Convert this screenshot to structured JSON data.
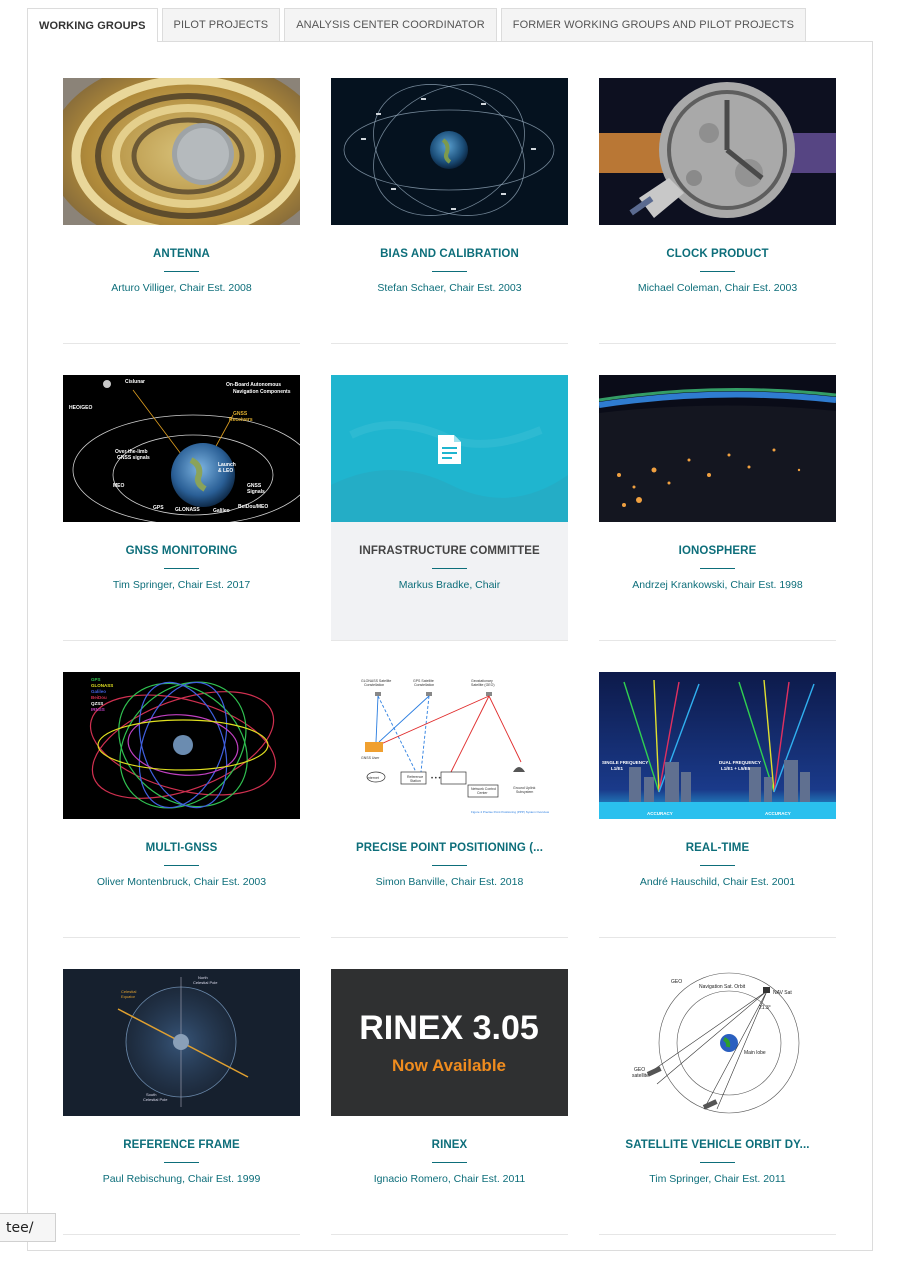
{
  "tabs": [
    {
      "label": "WORKING GROUPS",
      "active": true
    },
    {
      "label": "PILOT PROJECTS",
      "active": false
    },
    {
      "label": "ANALYSIS CENTER COORDINATOR",
      "active": false
    },
    {
      "label": "FORMER WORKING GROUPS AND PILOT PROJECTS",
      "active": false
    }
  ],
  "cards": [
    {
      "title": "ANTENNA",
      "subtitle": "Arturo Villiger, Chair Est. 2008",
      "image": "antenna-photo"
    },
    {
      "title": "BIAS AND CALIBRATION",
      "subtitle": "Stefan Schaer, Chair Est. 2003",
      "image": "earth-orbits-image"
    },
    {
      "title": "CLOCK PRODUCT",
      "subtitle": "Michael Coleman, Chair Est. 2003",
      "image": "moon-clock-image"
    },
    {
      "title": "GNSS MONITORING",
      "subtitle": "Tim Springer, Chair Est. 2017",
      "image": "navigation-diagram",
      "image_text": {
        "l1": "Cislunar",
        "l2": "On-Board Autonomous",
        "l3": "Navigation Components",
        "l4": "HEO/GEO",
        "l5": "GNSS",
        "l6": "Receivers",
        "l7": "Over-the-limb",
        "l8": "GNSS signals",
        "l9": "MEO",
        "l10": "GNSS",
        "l11": "Signals",
        "l12": "GPS",
        "l13": "GLONASS",
        "l14": "Galileo",
        "l15": "BeiDou/MEO",
        "l16": "Launch",
        "l17": "& LEO"
      }
    },
    {
      "title": "INFRASTRUCTURE COMMITTEE",
      "subtitle": "Markus Bradke, Chair",
      "image": "document-icon-placeholder",
      "highlight": true
    },
    {
      "title": "IONOSPHERE",
      "subtitle": "Andrzej Krankowski, Chair Est. 1998",
      "image": "earth-night-image"
    },
    {
      "title": "MULTI-GNSS",
      "subtitle": "Oliver Montenbruck, Chair Est. 2003",
      "image": "multi-orbit-image",
      "image_text": {
        "l1": "GPS",
        "l2": "GLONASS",
        "l3": "Galileo",
        "l4": "BeiDou",
        "l5": "QZSS",
        "l6": "IRNSS"
      }
    },
    {
      "title": "PRECISE POINT POSITIONING (...",
      "subtitle": "Simon Banville, Chair Est. 2018",
      "image": "ppp-diagram",
      "image_text": {
        "l1": "GLONASS Satellite",
        "l2": "Constellation",
        "l3": "GPS Satellite",
        "l4": "Constellation",
        "l5": "Geostationary",
        "l6": "Satellite (GEO)",
        "l7": "GNSS User",
        "l8": "Internet",
        "l9": "Reference",
        "l10": "Station",
        "l11": "Network Control",
        "l12": "Center",
        "l13": "Ground Uplink",
        "l14": "Subsystem",
        "l15": "Figure 4 Precise Point Positioning (PPP) System Overview"
      }
    },
    {
      "title": "REAL-TIME",
      "subtitle": "André Hauschild, Chair Est. 2001",
      "image": "frequency-diagram",
      "image_text": {
        "l1": "SINGLE FREQUENCY",
        "l2": "L1/E1",
        "l3": "DUAL FREQUENCY",
        "l4": "L1/E1 + L5/E5",
        "l5": "ACCURACY"
      }
    },
    {
      "title": "REFERENCE FRAME",
      "subtitle": "Paul Rebischung, Chair Est. 1999",
      "image": "celestial-sphere-image",
      "image_text": {
        "l1": "North",
        "l2": "Celestial Pole",
        "l3": "Celestial",
        "l4": "Equator",
        "l5": "South",
        "l6": "Celestial Pole"
      }
    },
    {
      "title": "RINEX",
      "subtitle": "Ignacio Romero, Chair Est. 2011",
      "image": "rinex-banner",
      "image_text": {
        "line1": "RINEX 3.05",
        "line2": "Now Available"
      }
    },
    {
      "title": "SATELLITE VEHICLE ORBIT DY...",
      "subtitle": "Tim Springer, Chair Est. 2011",
      "image": "orbit-diagram",
      "image_text": {
        "l1": "GEO",
        "l2": "Navigation Sat. Orbit",
        "l3": "NAV Sat",
        "l4": "21.3°",
        "l5": "Main lobe",
        "l6": "GEO",
        "l7": "satellite"
      }
    }
  ],
  "status_bar": {
    "url_fragment": "tee/"
  },
  "colors": {
    "accent": "#0d6e7a",
    "highlight_bg": "#f1f2f4"
  }
}
